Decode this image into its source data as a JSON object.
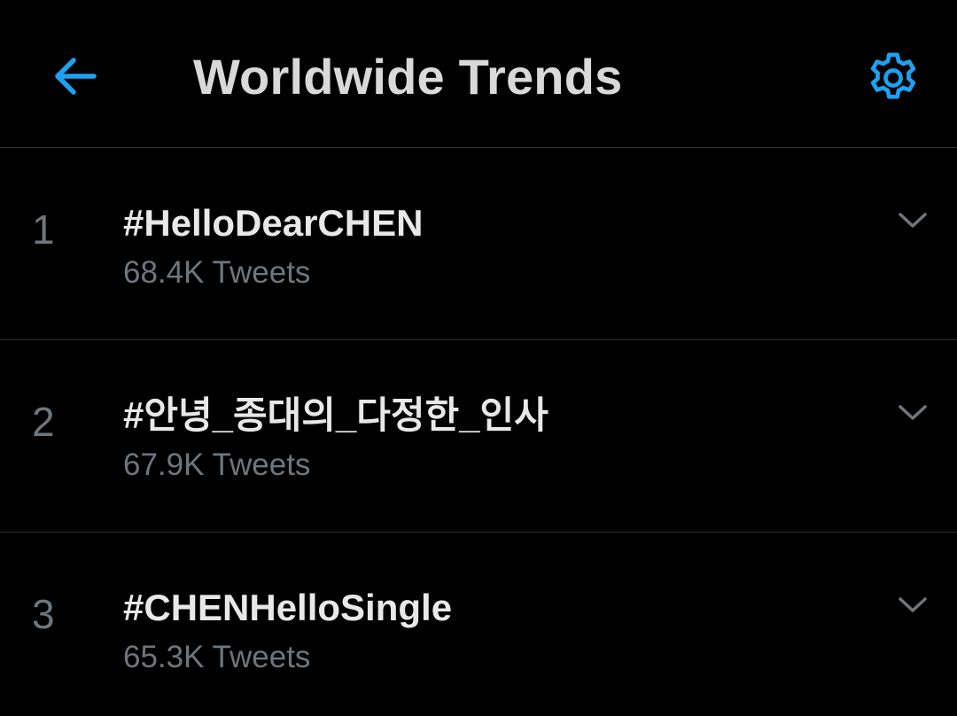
{
  "header": {
    "title": "Worldwide Trends",
    "back_icon": "arrow-left-icon",
    "settings_icon": "gear-icon"
  },
  "colors": {
    "accent": "#1da1f2",
    "background": "#000000",
    "divider": "#2f3336",
    "primary_text": "#e8e8e8",
    "secondary_text": "#6e767d"
  },
  "trends": [
    {
      "rank": "1",
      "name": "#HelloDearCHEN",
      "count": "68.4K Tweets",
      "menu_icon": "chevron-down-icon"
    },
    {
      "rank": "2",
      "name": "#안녕_종대의_다정한_인사",
      "count": "67.9K Tweets",
      "menu_icon": "chevron-down-icon"
    },
    {
      "rank": "3",
      "name": "#CHENHelloSingle",
      "count": "65.3K Tweets",
      "menu_icon": "chevron-down-icon"
    }
  ]
}
